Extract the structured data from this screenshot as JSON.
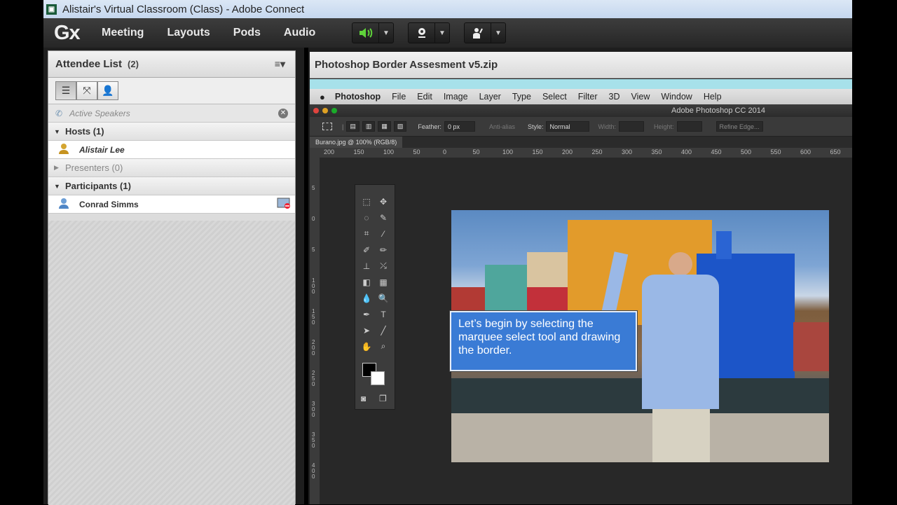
{
  "window": {
    "title": "Alistair's Virtual Classroom (Class) - Adobe Connect",
    "app_icon": "connect-app-icon"
  },
  "menubar": {
    "logo": "Gx",
    "items": [
      "Meeting",
      "Layouts",
      "Pods",
      "Audio"
    ]
  },
  "attendee_pod": {
    "title": "Attendee List",
    "count": "(2)",
    "active_speakers": "Active Speakers",
    "hosts_label": "Hosts (1)",
    "host_name": "Alistair Lee",
    "presenters_label": "Presenters (0)",
    "participants_label": "Participants (1)",
    "participant_name": "Conrad Simms"
  },
  "share_pod": {
    "title": "Photoshop Border Assesment v5.zip"
  },
  "photoshop": {
    "menu": [
      "Photoshop",
      "File",
      "Edit",
      "Image",
      "Layer",
      "Type",
      "Select",
      "Filter",
      "3D",
      "View",
      "Window",
      "Help"
    ],
    "window_title": "Adobe Photoshop CC 2014",
    "options": {
      "feather_label": "Feather:",
      "feather_value": "0 px",
      "antialias": "Anti-alias",
      "style_label": "Style:",
      "style_value": "Normal",
      "width_label": "Width:",
      "height_label": "Height:",
      "refine": "Refine Edge..."
    },
    "doc_tab": "Burano.jpg @ 100% (RGB/8)",
    "ruler_ticks": [
      "200",
      "150",
      "100",
      "50",
      "0",
      "50",
      "100",
      "150",
      "200",
      "250",
      "300",
      "350",
      "400",
      "450",
      "500",
      "550",
      "600",
      "650"
    ],
    "vruler_ticks": [
      "5",
      "0",
      "5",
      "1 0 0",
      "1 5 0",
      "2 0 0",
      "2 5 0",
      "3 0 0",
      "3 5 0",
      "4 0 0"
    ]
  },
  "callout": {
    "text": "Let’s begin by selecting the marquee select tool and drawing the border."
  },
  "colors": {
    "accent_green": "#5fd33a",
    "callout_blue": "#3a7bd5",
    "share_strip": "#a7e1ea"
  }
}
